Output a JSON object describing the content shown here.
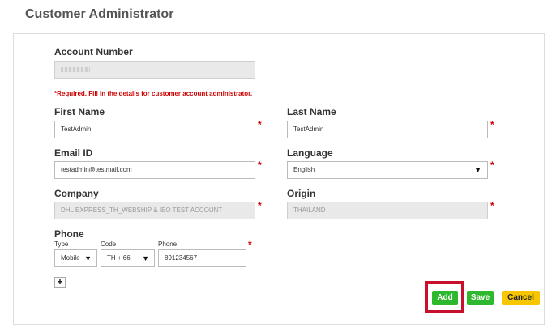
{
  "header": {
    "title": "Customer Administrator"
  },
  "account": {
    "label": "Account Number",
    "value": ""
  },
  "required_note": "*Required. Fill in the details for customer account administrator.",
  "first_name": {
    "label": "First Name",
    "value": "TestAdmin"
  },
  "last_name": {
    "label": "Last Name",
    "value": "TestAdmin"
  },
  "email": {
    "label": "Email ID",
    "value": "testadmin@testmail.com"
  },
  "language": {
    "label": "Language",
    "value": "English"
  },
  "company": {
    "label": "Company",
    "value": "DHL EXPRESS_TH_WEBSHIP & IEO TEST ACCOUNT"
  },
  "origin": {
    "label": "Origin",
    "value": "THAILAND"
  },
  "phone": {
    "label": "Phone",
    "type_label": "Type",
    "type_value": "Mobile",
    "code_label": "Code",
    "code_value": "TH + 66",
    "number_label": "Phone",
    "number_value": "891234567"
  },
  "required_mark": "*",
  "caret": "▼",
  "add_phone": "+",
  "buttons": {
    "add": "Add",
    "save": "Save",
    "cancel": "Cancel"
  },
  "colors": {
    "required": "#cc0000",
    "green": "#2db82d",
    "yellow": "#f7c600",
    "highlight": "#c8102e"
  },
  "icons": {
    "dropdown": "chevron-down-icon",
    "add_phone": "plus-icon"
  }
}
